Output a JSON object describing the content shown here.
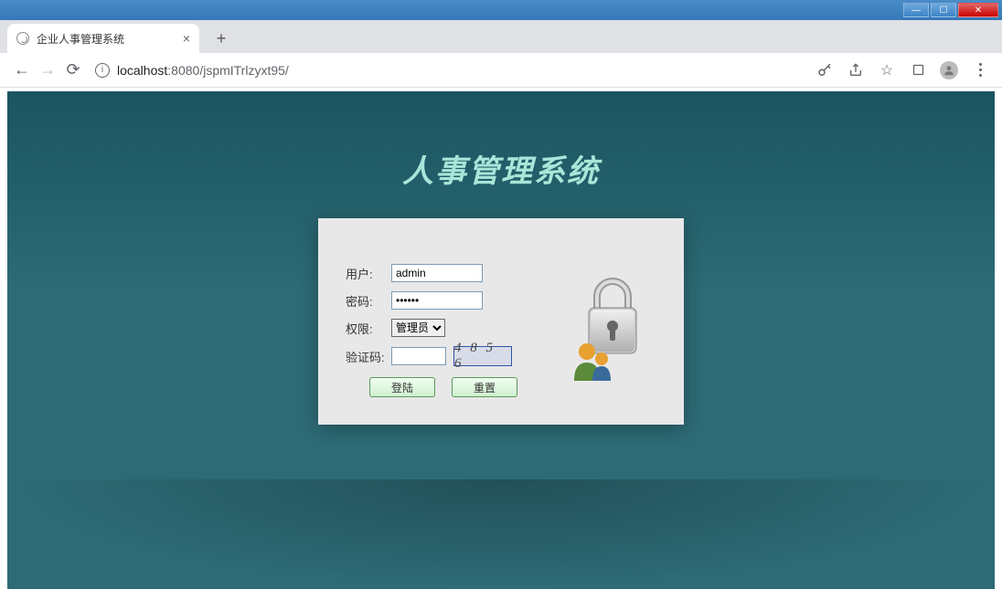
{
  "window": {
    "title": "企业人事管理系统"
  },
  "browser": {
    "tab_title": "企业人事管理系统",
    "url_host": "localhost",
    "url_port": ":8080",
    "url_path": "/jspmITrlzyxt95/"
  },
  "page": {
    "title": "人事管理系统"
  },
  "form": {
    "user_label": "用户:",
    "user_value": "admin",
    "pass_label": "密码:",
    "pass_value": "••••••",
    "role_label": "权限:",
    "role_selected": "管理员",
    "captcha_label": "验证码:",
    "captcha_value": "",
    "captcha_code": "4 8 5 6",
    "login_btn": "登陆",
    "reset_btn": "重置"
  }
}
